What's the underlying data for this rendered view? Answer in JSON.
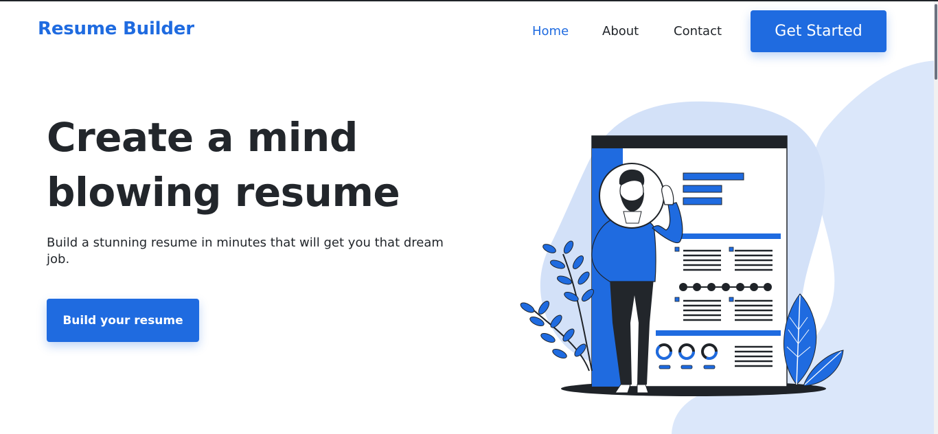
{
  "header": {
    "brand": "Resume Builder",
    "nav": [
      {
        "label": "Home",
        "active": true
      },
      {
        "label": "About",
        "active": false
      },
      {
        "label": "Contact",
        "active": false
      }
    ],
    "cta_label": "Get Started"
  },
  "hero": {
    "title_line1": "Create a mind",
    "title_line2": "blowing resume",
    "subtitle": "Build a stunning resume in minutes that will get you that dream job.",
    "cta_label": "Build your resume"
  },
  "illustration": {
    "name": "resume-illustration"
  },
  "colors": {
    "accent": "#1f6be0",
    "text": "#22262b",
    "blob": "#dbe7fa"
  }
}
